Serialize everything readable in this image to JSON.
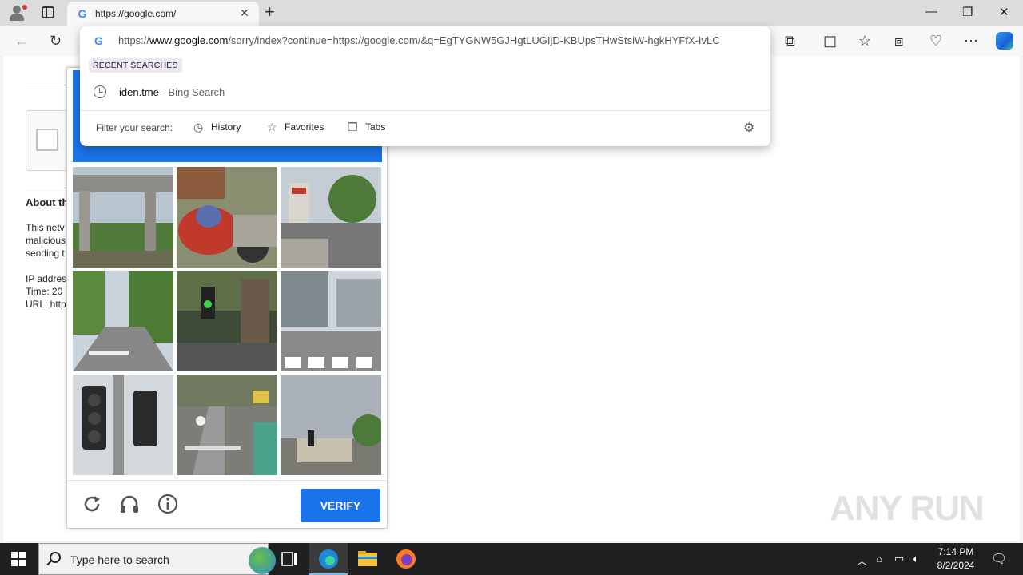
{
  "browser": {
    "tab_title": "https://google.com/",
    "tab_favicon": "G",
    "address_scheme": "https://",
    "address_host": "www.google.com",
    "address_path": "/sorry/index?continue=https://google.com/&q=EgTYGNW5GJHgtLUGIjD-KBUpsTHwStsiW-hgkHYFfX-IvLC"
  },
  "omnibox": {
    "recent_label": "RECENT SEARCHES",
    "suggestion_text": "iden.tme",
    "suggestion_source": " - Bing Search",
    "filter_label": "Filter your search:",
    "filters": [
      "History",
      "Favorites",
      "Tabs"
    ]
  },
  "page": {
    "about_heading": "About th",
    "para_lines": [
      "This netv",
      "malicious",
      "sending t"
    ],
    "info_lines": [
      "IP addres",
      "Time: 20",
      "URL: http"
    ]
  },
  "captcha": {
    "verify_label": "VERIFY",
    "tiles": [
      "overpass bridge",
      "motorcycle close-up",
      "street with signs",
      "tree-lined street",
      "traffic light green",
      "city intersection",
      "traffic lights close-up",
      "cyclist on road",
      "street with traffic light"
    ]
  },
  "watermark": "ANY RUN",
  "taskbar": {
    "search_placeholder": "Type here to search",
    "time": "7:14 PM",
    "date": "8/2/2024"
  },
  "colors": {
    "captcha_blue": "#1a73e8",
    "taskbar": "#1f1f1f"
  }
}
